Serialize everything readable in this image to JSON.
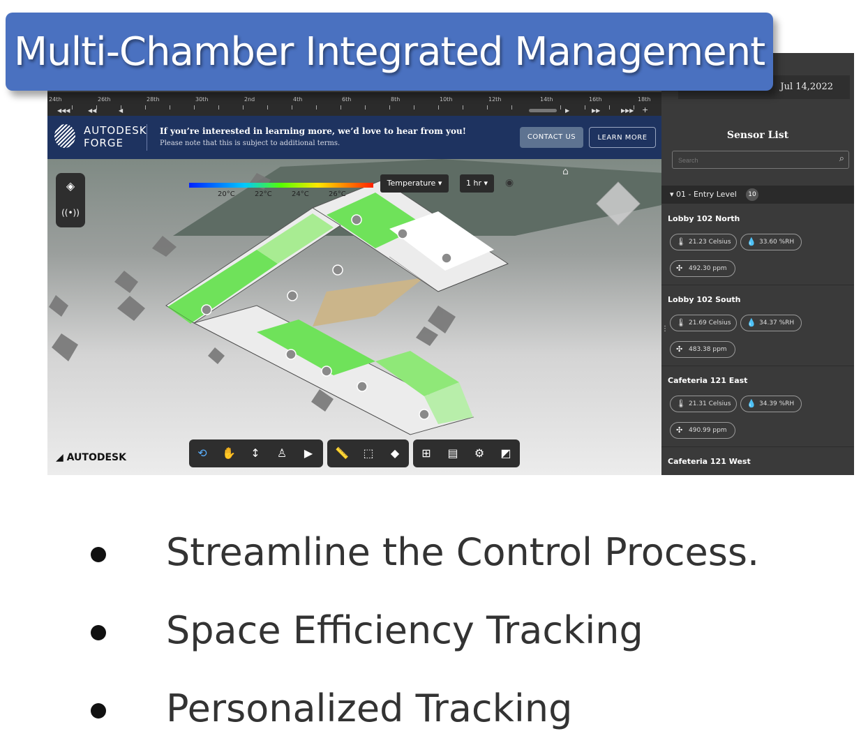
{
  "title": "Multi-Chamber Integrated Management",
  "timeline": {
    "labels": [
      "24th",
      "26th",
      "28th",
      "30th",
      "2nd",
      "4th",
      "6th",
      "8th",
      "10th",
      "12th",
      "14th",
      "16th",
      "18th"
    ]
  },
  "forge_bar": {
    "brand_line1": "AUTODESK",
    "brand_line2": "FORGE",
    "message": "If you’re interested in learning more, we’d love to hear from you!",
    "submessage": "Please note that this is subject to additional terms.",
    "contact_label": "CONTACT US",
    "learn_label": "LEARN MORE"
  },
  "viewer": {
    "colorbar_labels": [
      "20°C",
      "22°C",
      "24°C",
      "26°C"
    ],
    "metric_dropdown": "Temperature ▾",
    "time_dropdown": "1 hr ▾",
    "watermark": "AUTODESK"
  },
  "sidebar": {
    "date": "Jul 14,2022",
    "title": "Sensor List",
    "search_placeholder": "Search",
    "level_label": "▾  01 - Entry Level",
    "level_count": "10",
    "sensors": [
      {
        "name": "Lobby 102 North",
        "temp": "21.23 Celsius",
        "humidity": "33.60 %RH",
        "co2": "492.30 ppm"
      },
      {
        "name": "Lobby 102 South",
        "temp": "21.69 Celsius",
        "humidity": "34.37 %RH",
        "co2": "483.38 ppm"
      },
      {
        "name": "Cafeteria 121 East",
        "temp": "21.31 Celsius",
        "humidity": "34.39 %RH",
        "co2": "490.99 ppm"
      },
      {
        "name": "Cafeteria 121 West"
      }
    ]
  },
  "bullets": [
    "Streamline the Control Process.",
    "Space Efficiency Tracking",
    "Personalized Tracking"
  ],
  "colors": {
    "banner": "#4a71c0",
    "forge_bar": "#1e3360",
    "sidebar": "#3a3a3a",
    "heat_green": "#6fe25a"
  }
}
